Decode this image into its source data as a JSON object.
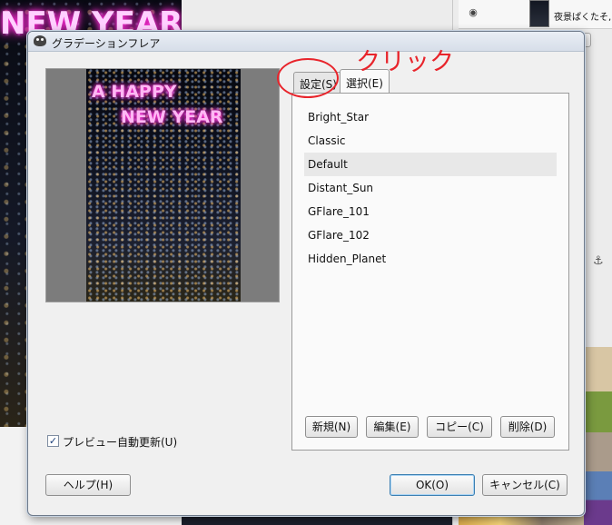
{
  "background": {
    "canvas_title": "NEW YEAR",
    "layer_name": "夜景ぱくたそ,"
  },
  "dialog": {
    "title": "グラデーションフレア",
    "preview": {
      "line1": "A HAPPY",
      "line2": "NEW YEAR"
    },
    "auto_update": {
      "label": "プレビュー自動更新(U)",
      "checked_glyph": "✓",
      "checked": true
    },
    "tabs": [
      {
        "label": "設定(S)",
        "active": false
      },
      {
        "label": "選択(E)",
        "active": true
      }
    ],
    "flare_list": [
      {
        "label": "Bright_Star",
        "selected": false
      },
      {
        "label": "Classic",
        "selected": false
      },
      {
        "label": "Default",
        "selected": true
      },
      {
        "label": "Distant_Sun",
        "selected": false
      },
      {
        "label": "GFlare_101",
        "selected": false
      },
      {
        "label": "GFlare_102",
        "selected": false
      },
      {
        "label": "Hidden_Planet",
        "selected": false
      }
    ],
    "list_buttons": {
      "new": "新規(N)",
      "edit": "編集(E)",
      "copy": "コピー(C)",
      "delete": "削除(D)"
    },
    "buttons": {
      "help": "ヘルプ(H)",
      "ok": "OK(O)",
      "cancel": "キャンセル(C)"
    }
  },
  "annotation": {
    "text": "クリック",
    "color": "#e8242b"
  },
  "icons": {
    "eye": "eye-icon",
    "app": "wilber-icon",
    "anchor": "anchor-icon"
  }
}
